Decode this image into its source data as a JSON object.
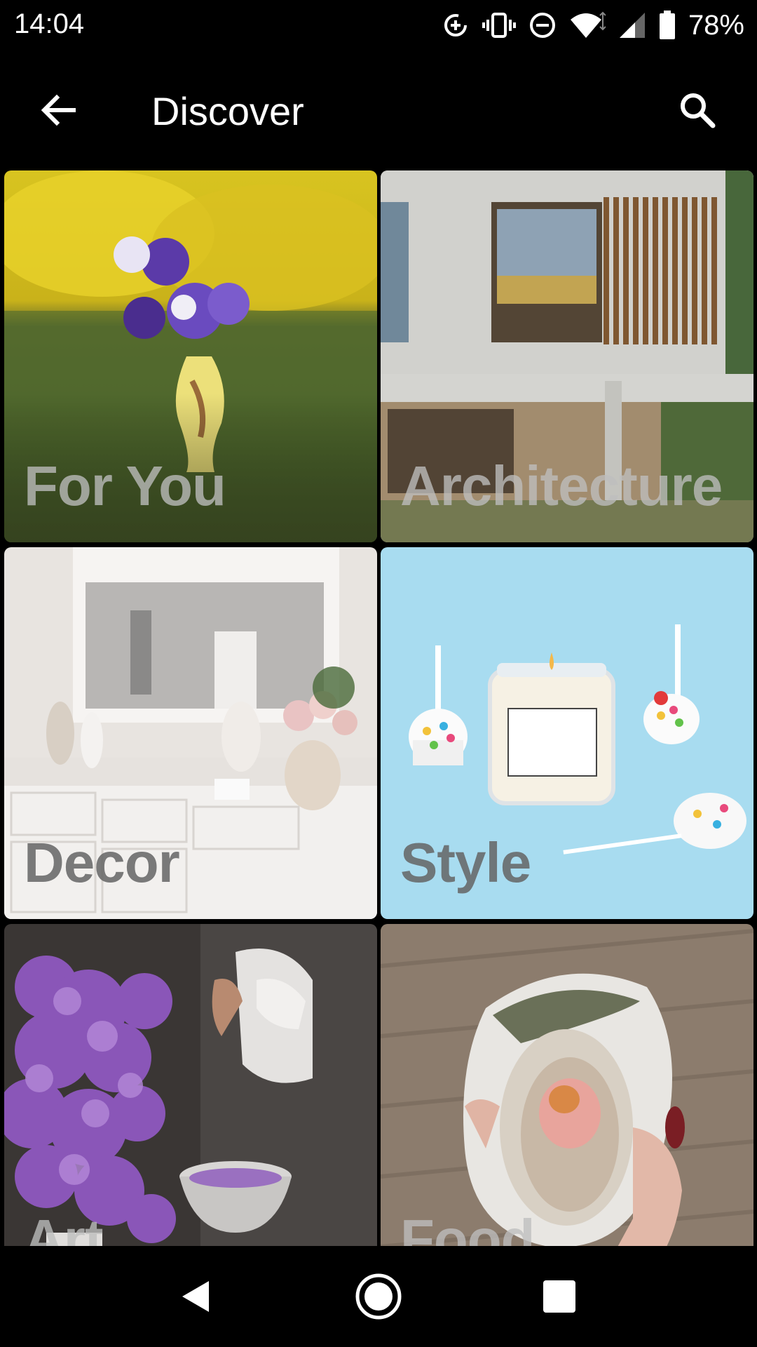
{
  "status_bar": {
    "time": "14:04",
    "battery_percent": "78%",
    "icons": [
      "data-saver-icon",
      "vibrate-icon",
      "do-not-disturb-icon",
      "wifi-icon",
      "cellular-signal-icon",
      "battery-icon"
    ]
  },
  "app_bar": {
    "title": "Discover",
    "back_icon": "arrow-back-icon",
    "search_icon": "search-icon"
  },
  "categories": [
    {
      "label": "For You"
    },
    {
      "label": "Architecture"
    },
    {
      "label": "Decor"
    },
    {
      "label": "Style"
    },
    {
      "label": "Art"
    },
    {
      "label": "Food"
    }
  ],
  "nav_bar": {
    "icons": [
      "back-triangle-icon",
      "home-circle-icon",
      "recents-square-icon"
    ]
  },
  "colors": {
    "background": "#000000",
    "text": "#ffffff",
    "label_overlay": "#bebebe"
  }
}
